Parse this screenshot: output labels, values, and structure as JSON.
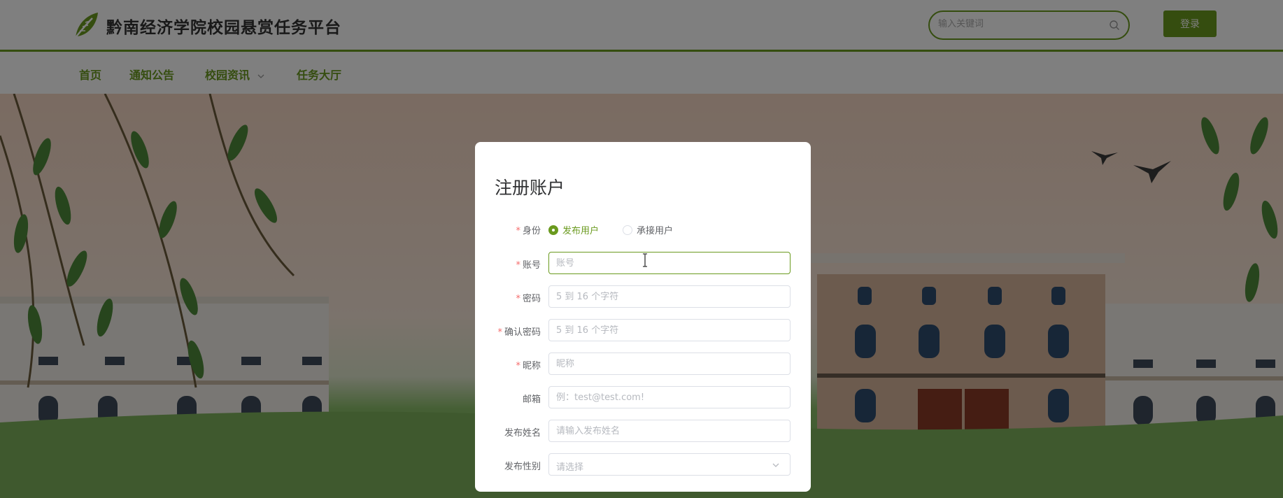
{
  "header": {
    "site_title": "黔南经济学院校园悬赏任务平台",
    "logo_icon": "leaf-logo-icon",
    "search_placeholder": "输入关键词",
    "search_icon": "search-icon",
    "login_label": "登录"
  },
  "nav": {
    "items": [
      {
        "label": "首页"
      },
      {
        "label": "通知公告"
      },
      {
        "label": "校园资讯",
        "has_dropdown": true
      },
      {
        "label": "任务大厅"
      }
    ]
  },
  "colors": {
    "accent": "#6a9a1e",
    "required": "#f56c6c"
  },
  "register_modal": {
    "title": "注册账户",
    "identity": {
      "label": "身份",
      "required": true,
      "options": [
        {
          "label": "发布用户",
          "checked": true
        },
        {
          "label": "承接用户",
          "checked": false
        }
      ]
    },
    "fields": [
      {
        "key": "account",
        "label": "账号",
        "required": true,
        "placeholder": "账号",
        "value": ""
      },
      {
        "key": "password",
        "label": "密码",
        "required": true,
        "placeholder": "5 到 16 个字符",
        "value": ""
      },
      {
        "key": "confirm_password",
        "label": "确认密码",
        "required": true,
        "placeholder": "5 到 16 个字符",
        "value": ""
      },
      {
        "key": "nickname",
        "label": "昵称",
        "required": true,
        "placeholder": "昵称",
        "value": ""
      },
      {
        "key": "email",
        "label": "邮箱",
        "required": false,
        "placeholder": "例：test@test.com!",
        "value": ""
      },
      {
        "key": "publisher_name",
        "label": "发布姓名",
        "required": false,
        "placeholder": "请输入发布姓名",
        "value": ""
      }
    ],
    "gender_select": {
      "label": "发布性别",
      "required": false,
      "placeholder": "请选择"
    },
    "required_mark": "*"
  }
}
